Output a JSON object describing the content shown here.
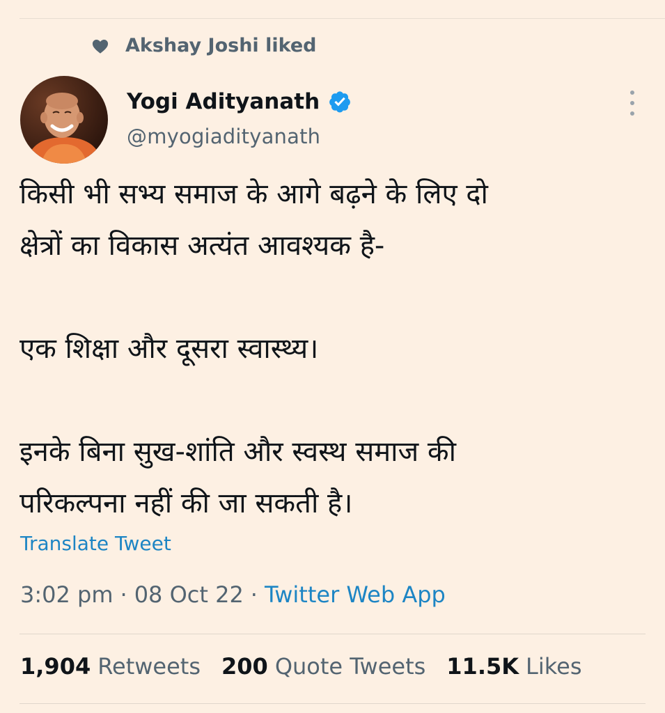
{
  "social_context": {
    "icon": "heart-icon",
    "text": "Akshay Joshi liked"
  },
  "author": {
    "display_name": "Yogi Adityanath",
    "handle": "@myogiadityanath",
    "verified": true,
    "verified_color": "#1d9bf0",
    "avatar": "avatar"
  },
  "tweet": {
    "text": "किसी भी सभ्य समाज के आगे बढ़ने के लिए दो\nक्षेत्रों का विकास अत्यंत आवश्यक है-\n\nएक शिक्षा और दूसरा स्वास्थ्य।\n\nइनके बिना सुख-शांति और स्वस्थ समाज की\nपरिकल्पना नहीं की जा सकती है।",
    "translate_label": "Translate Tweet",
    "time": "3:02 pm",
    "date": "08 Oct 22",
    "separator": "·",
    "source": "Twitter Web App"
  },
  "stats": {
    "retweets_count": "1,904",
    "retweets_label": "Retweets",
    "quotes_count": "200",
    "quotes_label": "Quote Tweets",
    "likes_count": "11.5K",
    "likes_label": "Likes"
  },
  "colors": {
    "background": "#fdf0e3",
    "link": "#1d85c4",
    "secondary_text": "#536471"
  }
}
